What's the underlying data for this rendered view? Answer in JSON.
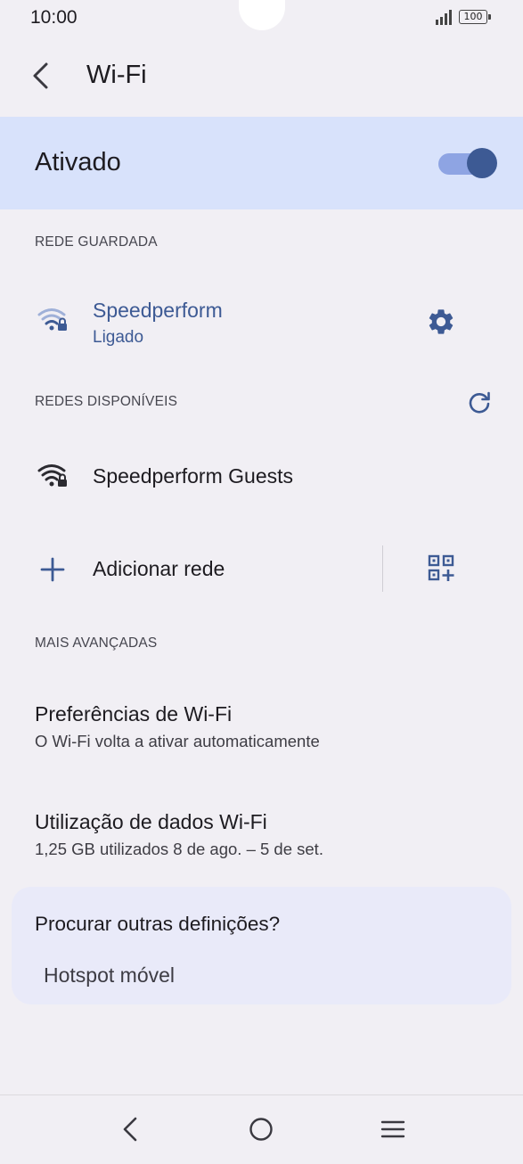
{
  "status_bar": {
    "time": "10:00",
    "battery": "100"
  },
  "toolbar": {
    "title": "Wi-Fi"
  },
  "master_switch": {
    "label": "Ativado",
    "on": true
  },
  "saved_network": {
    "header": "REDE GUARDADA",
    "name": "Speedperform",
    "status": "Ligado"
  },
  "available_networks": {
    "header": "REDES DISPONÍVEIS",
    "items": [
      {
        "name": "Speedperform Guests"
      }
    ]
  },
  "add_network": {
    "label": "Adicionar rede"
  },
  "advanced": {
    "header": "MAIS AVANÇADAS",
    "items": [
      {
        "title": "Preferências de Wi-Fi",
        "subtitle": "O Wi-Fi volta a ativar automaticamente"
      },
      {
        "title": "Utilização de dados Wi-Fi",
        "subtitle": "1,25 GB utilizados 8 de ago. – 5 de set."
      }
    ]
  },
  "suggestions": {
    "title": "Procurar outras definições?",
    "items": [
      "Hotspot móvel"
    ]
  },
  "colors": {
    "accent": "#3d5a94",
    "highlight": "#d8e2fb",
    "background": "#f1eff4"
  }
}
